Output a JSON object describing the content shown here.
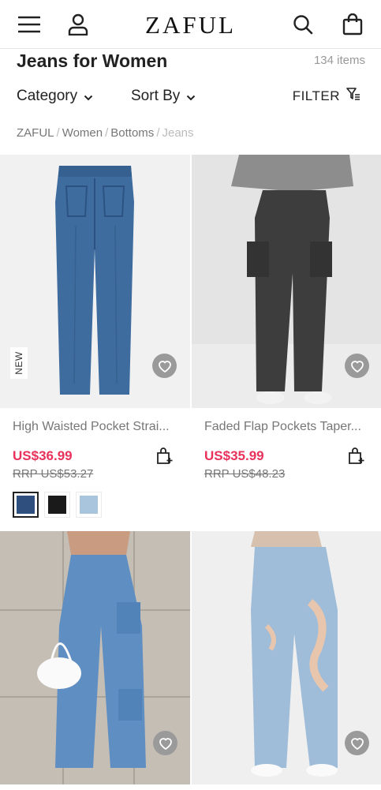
{
  "header": {
    "logo": "ZAFUL",
    "icons": [
      "menu-icon",
      "account-icon",
      "search-icon",
      "cart-icon"
    ]
  },
  "page": {
    "title": "Jeans for Women",
    "item_count": "134 items"
  },
  "controls": {
    "category_label": "Category",
    "sort_label": "Sort By",
    "filter_label": "FILTER"
  },
  "breadcrumb": [
    "ZAFUL",
    "Women",
    "Bottoms",
    "Jeans"
  ],
  "products": [
    {
      "name": "High Waisted Pocket Strai...",
      "price": "US$36.99",
      "rrp": "RRP US$53.27",
      "badge": "NEW",
      "swatches": [
        "#2f4f7e",
        "#1a1a1a",
        "#a9c4dd"
      ]
    },
    {
      "name": "Faded Flap Pockets Taper...",
      "price": "US$35.99",
      "rrp": "RRP US$48.23"
    },
    {},
    {}
  ],
  "colors": {
    "price": "#e8315b",
    "text": "#222222",
    "muted": "#777777",
    "fav_button": "#9a9a9a"
  }
}
